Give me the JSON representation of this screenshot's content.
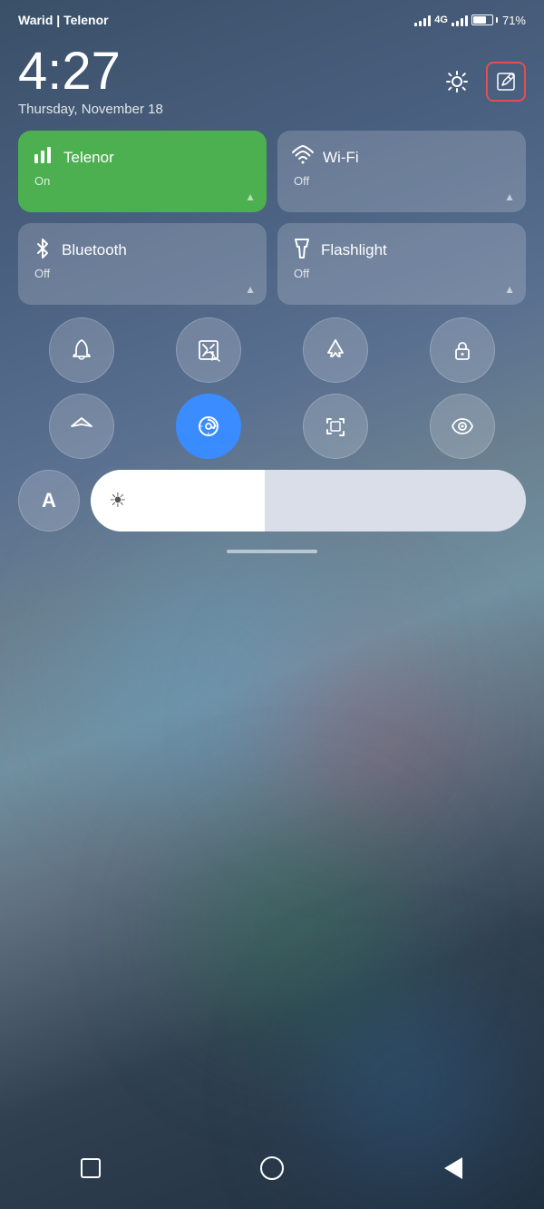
{
  "statusBar": {
    "carrier": "Warid | Telenor",
    "battery_percent": "71%",
    "badge_4g": "4G"
  },
  "clock": {
    "time": "4:27",
    "date": "Thursday, November 18"
  },
  "toggles": [
    {
      "id": "telenor",
      "label": "Telenor",
      "status": "On",
      "active": true,
      "icon": "≡"
    },
    {
      "id": "wifi",
      "label": "Wi-Fi",
      "status": "Off",
      "active": false,
      "icon": "wifi"
    },
    {
      "id": "bluetooth",
      "label": "Bluetooth",
      "status": "Off",
      "active": false,
      "icon": "bluetooth"
    },
    {
      "id": "flashlight",
      "label": "Flashlight",
      "status": "Off",
      "active": false,
      "icon": "flashlight"
    }
  ],
  "roundButtons": [
    {
      "id": "bell",
      "label": "Sound",
      "active": false,
      "icon": "bell"
    },
    {
      "id": "screenshot",
      "label": "Screenshot",
      "active": false,
      "icon": "screenshot"
    },
    {
      "id": "airplane",
      "label": "Airplane Mode",
      "active": false,
      "icon": "airplane"
    },
    {
      "id": "lock",
      "label": "Lock Rotation",
      "active": false,
      "icon": "lock"
    }
  ],
  "roundButtons2": [
    {
      "id": "location",
      "label": "Location",
      "active": false,
      "icon": "location"
    },
    {
      "id": "autorotate",
      "label": "Auto Rotate",
      "active": true,
      "icon": "autorotate"
    },
    {
      "id": "scan",
      "label": "Scan",
      "active": false,
      "icon": "scan"
    },
    {
      "id": "privacy",
      "label": "Privacy",
      "active": false,
      "icon": "eye"
    }
  ],
  "brightness": {
    "font_label": "A",
    "icon": "☀",
    "value": 40
  },
  "navBar": {
    "back_label": "Back",
    "home_label": "Home",
    "recents_label": "Recents"
  },
  "editButton": {
    "highlighted": true
  }
}
